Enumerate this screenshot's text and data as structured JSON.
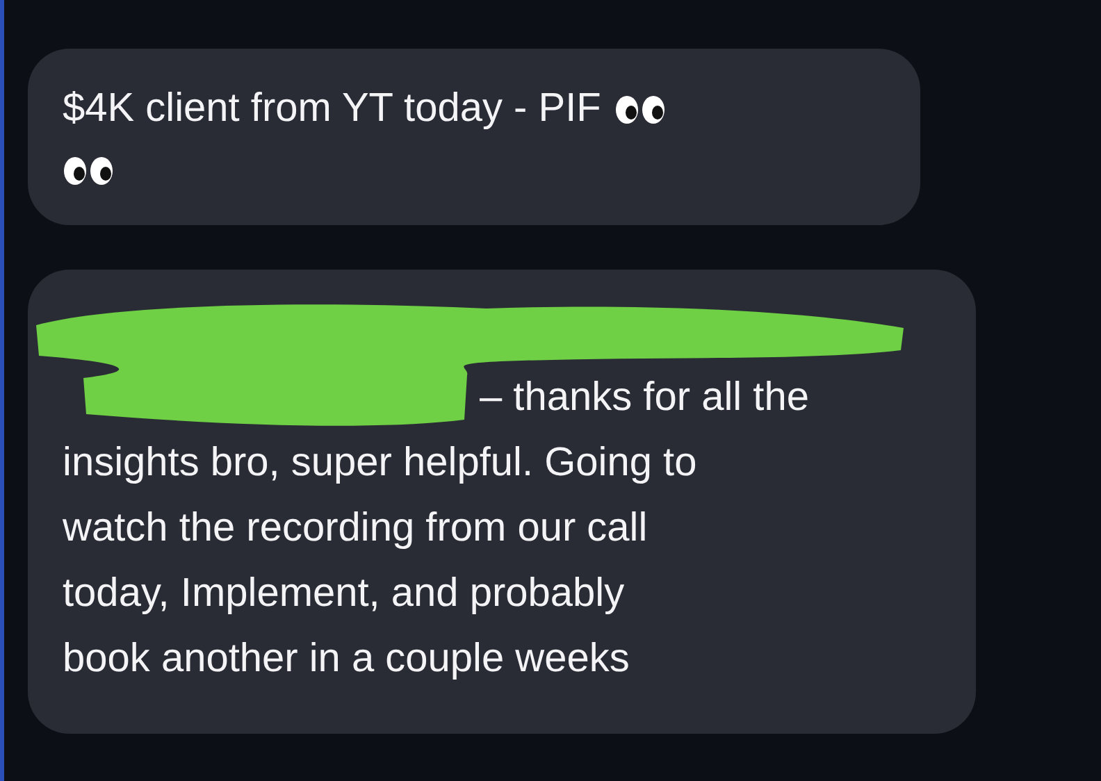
{
  "messages": [
    {
      "lines": [
        "$4K client from YT today - PIF"
      ],
      "icons": [
        {
          "kind": "eyes"
        },
        {
          "kind": "eyes"
        }
      ],
      "redacted": false
    },
    {
      "lines": [
        "– thanks for all the",
        "insights bro, super helpful. Going to",
        "watch the recording from our call",
        "today, Implement, and probably",
        "book another in a couple weeks"
      ],
      "redacted": true
    }
  ]
}
